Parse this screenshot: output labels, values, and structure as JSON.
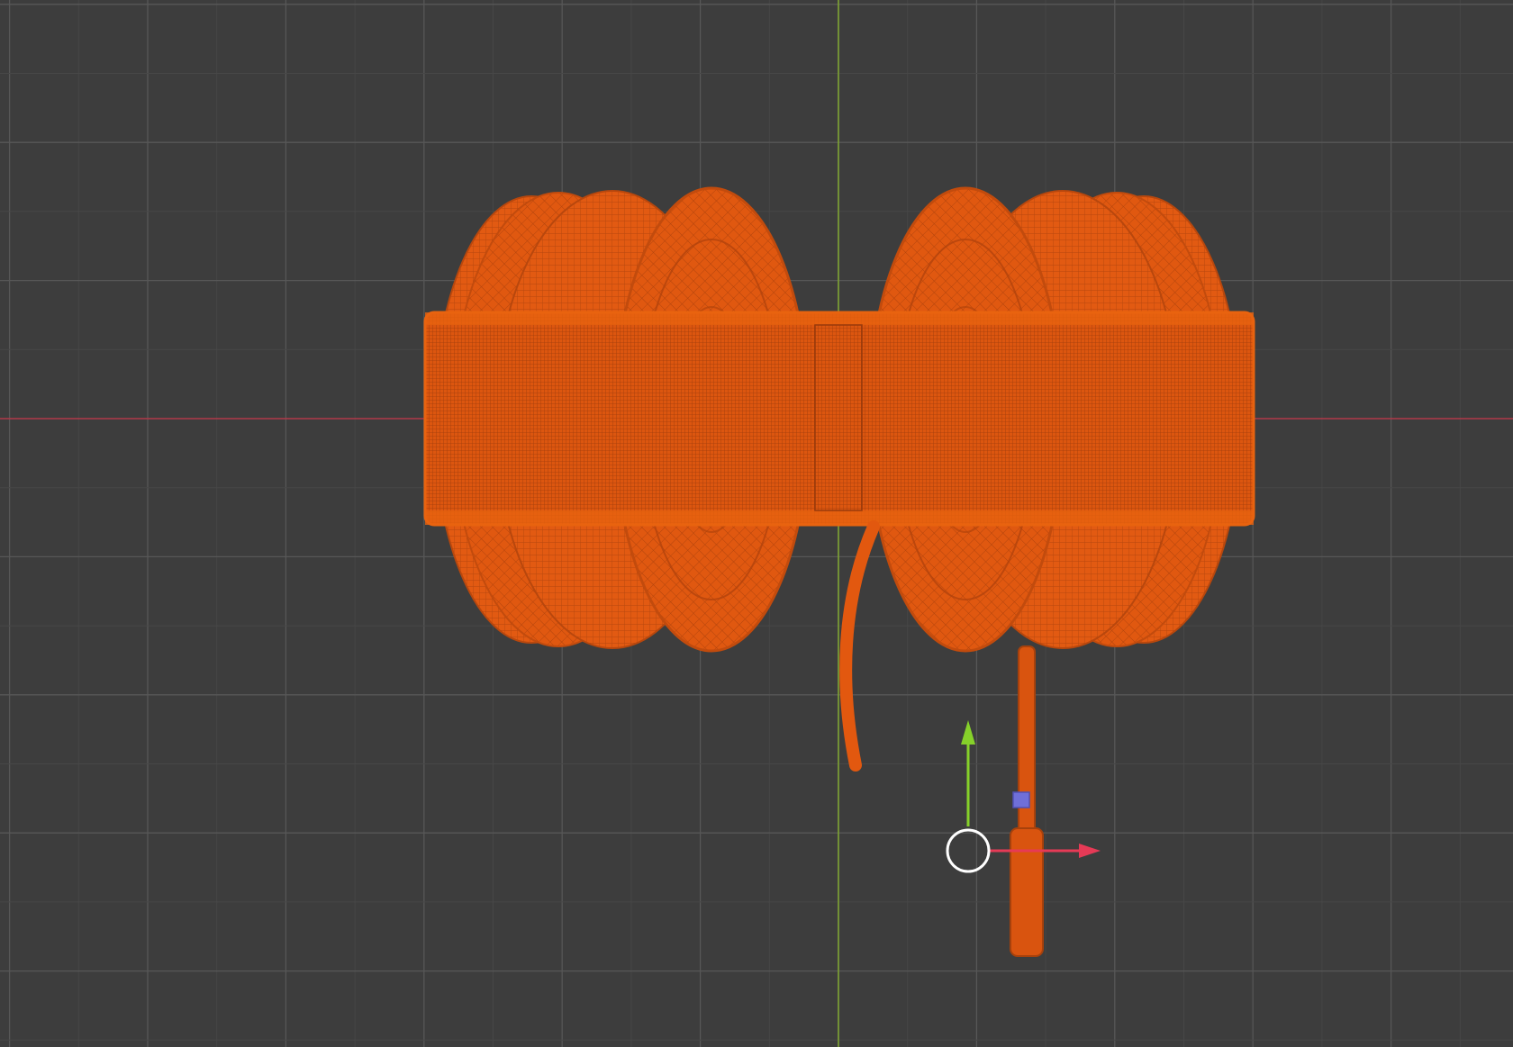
{
  "viewport": {
    "view": "front-orthographic",
    "background_color": "#3d3d3d",
    "grid_color": "#575757",
    "x_axis_color": "#b03848",
    "y_axis_color": "#7fa333"
  },
  "object": {
    "type": "headphones-model",
    "display": "wireframe",
    "selected": true,
    "selection_color": "#e8590c"
  },
  "gizmo": {
    "mode": "move",
    "x_arrow_color": "#e63a56",
    "y_arrow_color": "#86d12a",
    "plane_handle_color": "#6f6fd8",
    "pivot_color": "#ffffff",
    "icons": [
      "x-arrow-icon",
      "y-arrow-icon",
      "xy-plane-handle-icon",
      "pivot-circle-icon"
    ]
  }
}
